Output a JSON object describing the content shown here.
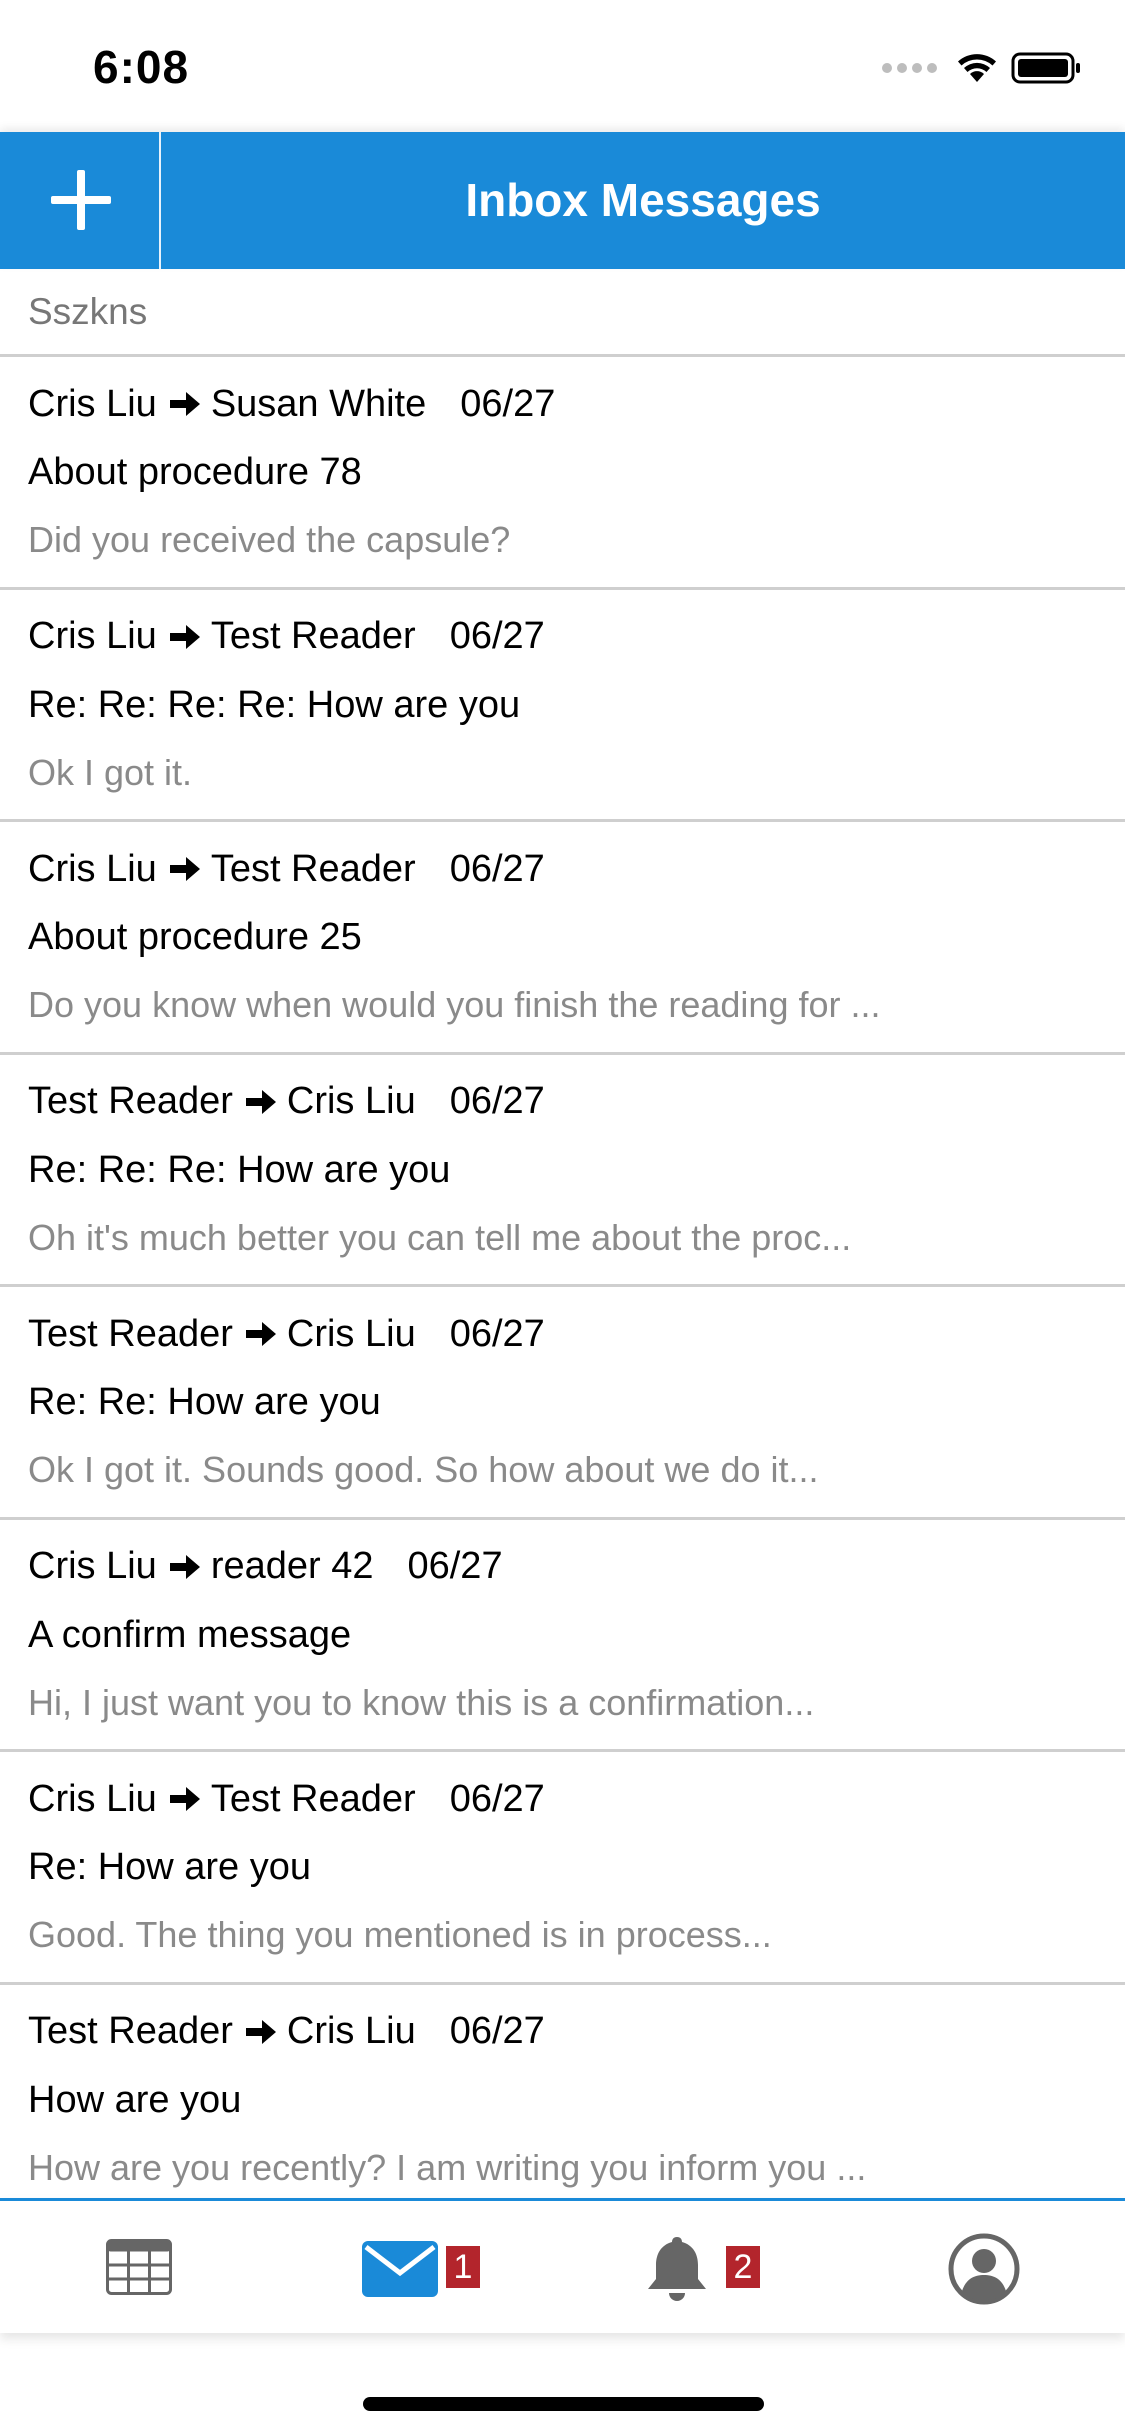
{
  "status_bar": {
    "time": "6:08"
  },
  "header": {
    "title": "Inbox Messages",
    "accent_color": "#1a8ad8"
  },
  "search": {
    "value": "Sszkns"
  },
  "messages": [
    {
      "from": "Cris Liu",
      "to": "Susan White",
      "date": "06/27",
      "subject": "About procedure 78",
      "preview": "Did you received the capsule?"
    },
    {
      "from": "Cris Liu",
      "to": "Test Reader",
      "date": "06/27",
      "subject": "Re: Re: Re: Re: How are you",
      "preview": "Ok I got it."
    },
    {
      "from": "Cris Liu",
      "to": "Test Reader",
      "date": "06/27",
      "subject": "About procedure 25",
      "preview": "Do you know when would you finish the reading for ..."
    },
    {
      "from": "Test Reader",
      "to": "Cris Liu",
      "date": "06/27",
      "subject": "Re: Re: Re: How are you",
      "preview": "Oh it's much better you can tell me about the proc..."
    },
    {
      "from": "Test Reader",
      "to": "Cris Liu",
      "date": "06/27",
      "subject": "Re: Re: How are you",
      "preview": "Ok I got it. Sounds good. So how about we do it..."
    },
    {
      "from": "Cris Liu",
      "to": "reader 42",
      "date": "06/27",
      "subject": "A confirm message",
      "preview": "Hi, I just want you to know this is a confirmation..."
    },
    {
      "from": "Cris Liu",
      "to": "Test Reader",
      "date": "06/27",
      "subject": "Re: How are you",
      "preview": "Good. The thing you mentioned is in process..."
    },
    {
      "from": "Test Reader",
      "to": "Cris Liu",
      "date": "06/27",
      "subject": "How are you",
      "preview": "How are you recently? I am writing you inform you ..."
    }
  ],
  "tab_bar": {
    "tabs": [
      {
        "icon": "grid-icon",
        "active": false
      },
      {
        "icon": "mail-icon",
        "active": true,
        "badge": "1"
      },
      {
        "icon": "bell-icon",
        "active": false,
        "badge": "2"
      },
      {
        "icon": "user-icon",
        "active": false
      }
    ],
    "active_color": "#1a8ad8",
    "inactive_color": "#666666",
    "badge_color": "#b3252c"
  }
}
